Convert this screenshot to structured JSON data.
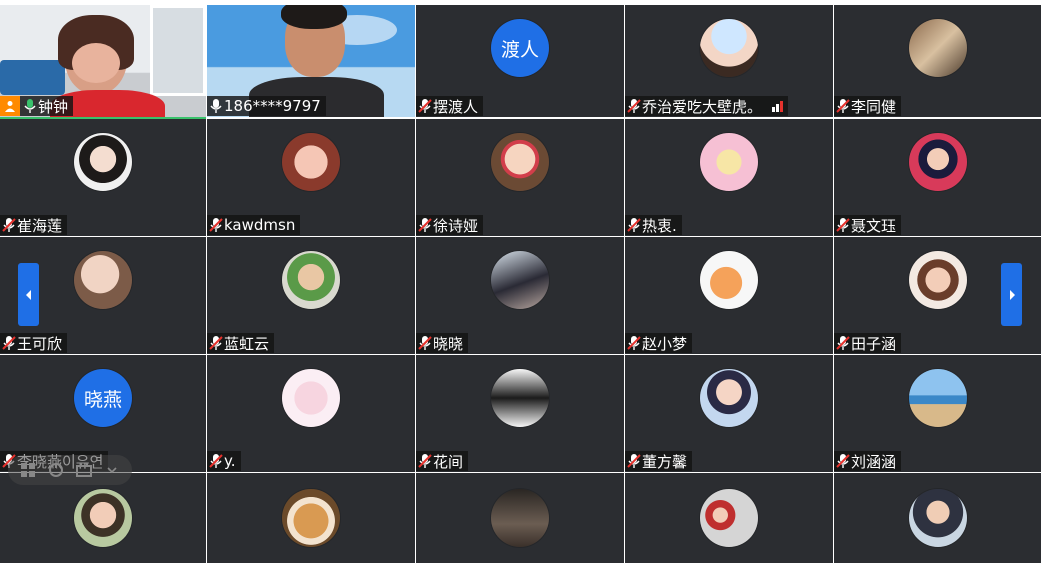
{
  "colors": {
    "tile_bg": "#2b2d31",
    "accent_blue": "#1f6fe6",
    "host_orange": "#ff8a00",
    "speaking_green": "#39c26c",
    "muted_red": "#e5322d"
  },
  "participants": [
    {
      "name": "钟钟",
      "video": true,
      "host": true,
      "mic": "speaking"
    },
    {
      "name": "186****9797",
      "video": true,
      "mic": "on"
    },
    {
      "name": "摆渡人",
      "avatar_text": "渡人",
      "mic": "muted"
    },
    {
      "name": "乔治爱吃大壁虎。",
      "mic": "muted",
      "signal": true
    },
    {
      "name": "李同健",
      "mic": "muted"
    },
    {
      "name": "崔海莲",
      "mic": "muted"
    },
    {
      "name": "kawdmsn",
      "mic": "muted"
    },
    {
      "name": "徐诗娅",
      "mic": "muted"
    },
    {
      "name": "热衷.",
      "mic": "muted"
    },
    {
      "name": "聂文珏",
      "mic": "muted"
    },
    {
      "name": "王可欣",
      "mic": "muted"
    },
    {
      "name": "蓝虹云",
      "mic": "muted"
    },
    {
      "name": "晓晓",
      "mic": "muted"
    },
    {
      "name": "赵小梦",
      "mic": "muted"
    },
    {
      "name": "田子涵",
      "mic": "muted"
    },
    {
      "name": "李晓燕이유연",
      "avatar_text": "晓燕",
      "mic": "muted"
    },
    {
      "name": "y.",
      "mic": "muted"
    },
    {
      "name": "花间",
      "mic": "muted"
    },
    {
      "name": "董方馨",
      "mic": "muted"
    },
    {
      "name": "刘涵涵",
      "mic": "muted"
    },
    {
      "name": "",
      "mic": ""
    },
    {
      "name": "",
      "mic": ""
    },
    {
      "name": "",
      "mic": ""
    },
    {
      "name": "",
      "mic": ""
    },
    {
      "name": "",
      "mic": ""
    }
  ],
  "navigation": {
    "prev": "chevron-left-icon",
    "next": "chevron-right-icon"
  },
  "toolbar": {
    "icons": [
      "grid-view-icon",
      "refresh-icon",
      "screen-share-icon",
      "chevron-down-icon"
    ]
  }
}
